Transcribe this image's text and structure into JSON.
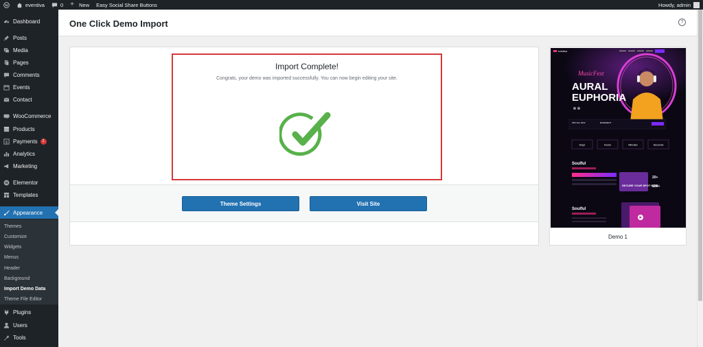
{
  "admin_bar": {
    "site_name": "eventiva",
    "comments_count": "0",
    "new_label": "New",
    "plugin_link": "Easy Social Share Buttons",
    "greeting": "Howdy, admin"
  },
  "sidebar": {
    "items": [
      {
        "label": "Dashboard",
        "icon": "dashboard-icon"
      },
      {
        "label": "Posts",
        "icon": "pin-icon"
      },
      {
        "label": "Media",
        "icon": "media-icon"
      },
      {
        "label": "Pages",
        "icon": "pages-icon"
      },
      {
        "label": "Comments",
        "icon": "comments-icon"
      },
      {
        "label": "Events",
        "icon": "calendar-icon"
      },
      {
        "label": "Contact",
        "icon": "mail-icon"
      },
      {
        "label": "WooCommerce",
        "icon": "woocommerce-icon"
      },
      {
        "label": "Products",
        "icon": "products-icon"
      },
      {
        "label": "Payments",
        "icon": "payments-icon",
        "badge": "1"
      },
      {
        "label": "Analytics",
        "icon": "analytics-icon"
      },
      {
        "label": "Marketing",
        "icon": "marketing-icon"
      },
      {
        "label": "Elementor",
        "icon": "elementor-icon"
      },
      {
        "label": "Templates",
        "icon": "templates-icon"
      },
      {
        "label": "Appearance",
        "icon": "appearance-icon"
      },
      {
        "label": "Plugins",
        "icon": "plugins-icon"
      },
      {
        "label": "Users",
        "icon": "users-icon"
      },
      {
        "label": "Tools",
        "icon": "tools-icon"
      }
    ],
    "submenu": [
      "Themes",
      "Customize",
      "Widgets",
      "Menus",
      "Header",
      "Background",
      "Import Demo Data",
      "Theme File Editor"
    ]
  },
  "page": {
    "title": "One Click Demo Import",
    "help": "?"
  },
  "result": {
    "title": "Import Complete!",
    "message": "Congrats, your demo was imported successfully. You can now begin editing your site."
  },
  "buttons": {
    "theme_settings": "Theme Settings",
    "visit_site": "Visit Site"
  },
  "demo": {
    "name": "Demo 1",
    "thumb": {
      "brand": "eventiva",
      "script": "MusicFest",
      "headline_1": "AURAL",
      "headline_2": "EUPHORIA",
      "date_label": "25th Dec 2022",
      "venue_label": "BASEMENT",
      "countdown": [
        "Days",
        "Hours",
        "Minutes",
        "Seconds"
      ],
      "section_title": "Soulful",
      "promo": "SECURE YOUR SPOT NOW",
      "stat_1": "20+",
      "stat_2": "100+",
      "section_title_2": "Soulful"
    }
  },
  "colors": {
    "admin_dark": "#1d2327",
    "accent_blue": "#2271b1",
    "highlight_red": "#d63638",
    "check_green": "#58b14a"
  }
}
